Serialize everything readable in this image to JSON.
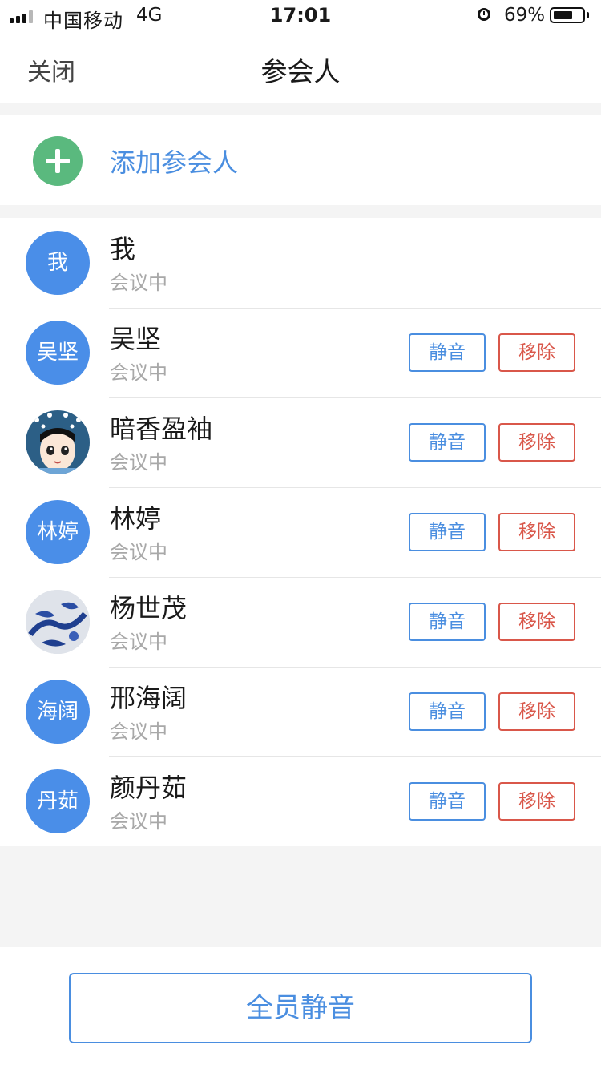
{
  "status_bar": {
    "carrier": "中国移动",
    "network": "4G",
    "time": "17:01",
    "battery_percent": "69%",
    "battery_level": 0.69,
    "signal_bars_filled": 3,
    "signal_bars_total": 4,
    "icons": [
      "signal-icon",
      "alarm-icon",
      "battery-icon"
    ]
  },
  "nav": {
    "close_label": "关闭",
    "title": "参会人"
  },
  "add": {
    "icon": "plus-circle-icon",
    "label": "添加参会人",
    "icon_color": "#5ab97e"
  },
  "participants": [
    {
      "name": "我",
      "avatar_text": "我",
      "avatar_type": "initials",
      "status": "会议中",
      "actions": false
    },
    {
      "name": "吴坚",
      "avatar_text": "吴坚",
      "avatar_type": "initials",
      "status": "会议中",
      "actions": true
    },
    {
      "name": "暗香盈袖",
      "avatar_text": "",
      "avatar_type": "photo-cartoon-girl",
      "status": "会议中",
      "actions": true
    },
    {
      "name": "林婷",
      "avatar_text": "林婷",
      "avatar_type": "initials",
      "status": "会议中",
      "actions": true
    },
    {
      "name": "杨世茂",
      "avatar_text": "",
      "avatar_type": "photo-blue-porcelain",
      "status": "会议中",
      "actions": true
    },
    {
      "name": "邢海阔",
      "avatar_text": "海阔",
      "avatar_type": "initials",
      "status": "会议中",
      "actions": true
    },
    {
      "name": "颜丹茹",
      "avatar_text": "丹茹",
      "avatar_type": "initials",
      "status": "会议中",
      "actions": true
    }
  ],
  "actions": {
    "mute_label": "静音",
    "remove_label": "移除"
  },
  "footer": {
    "mute_all_label": "全员静音"
  },
  "colors": {
    "accent_blue": "#4a8ee0",
    "avatar_blue": "#4a8ee8",
    "remove_red": "#d9574a",
    "add_green": "#5ab97e",
    "page_background": "#f4f4f4"
  }
}
